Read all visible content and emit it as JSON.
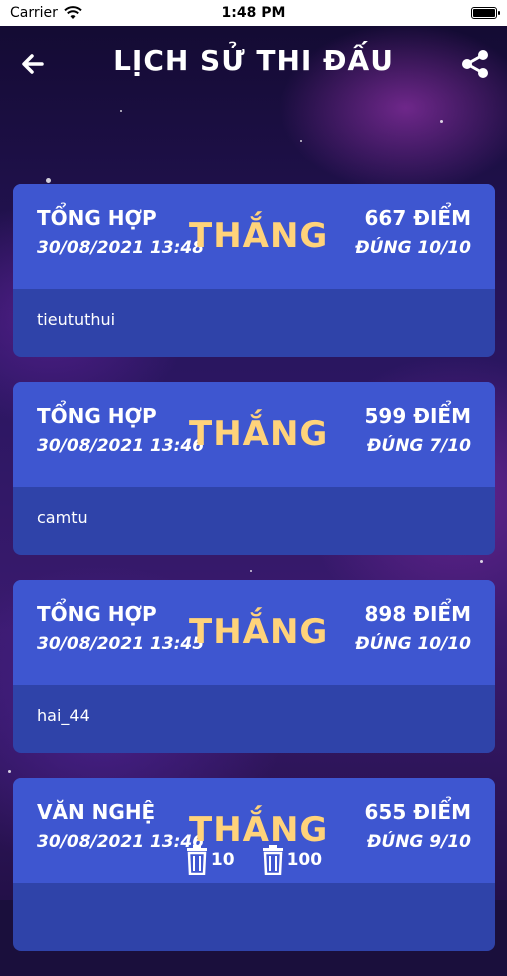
{
  "status_bar": {
    "carrier": "Carrier",
    "time": "1:48 PM"
  },
  "header": {
    "title": "LỊCH SỬ THI ĐẤU",
    "back_icon": "arrow-left-icon",
    "share_icon": "share-icon"
  },
  "matches": [
    {
      "category": "TỔNG HỢP",
      "datetime": "30/08/2021 13:48",
      "result": "THẮNG",
      "score": "667 ĐIỂM",
      "correct": "ĐÚNG 10/10",
      "user": "tieututhui"
    },
    {
      "category": "TỔNG HỢP",
      "datetime": "30/08/2021 13:46",
      "result": "THẮNG",
      "score": "599 ĐIỂM",
      "correct": "ĐÚNG 7/10",
      "user": "camtu"
    },
    {
      "category": "TỔNG HỢP",
      "datetime": "30/08/2021 13:45",
      "result": "THẮNG",
      "score": "898 ĐIỂM",
      "correct": "ĐÚNG 10/10",
      "user": "hai_44"
    },
    {
      "category": "VĂN NGHỆ",
      "datetime": "30/08/2021 13:46",
      "result": "THẮNG",
      "score": "655 ĐIỂM",
      "correct": "ĐÚNG 9/10",
      "user": ""
    }
  ],
  "bottom_actions": [
    {
      "icon": "trash-icon",
      "label": "10"
    },
    {
      "icon": "trash-icon",
      "label": "100"
    }
  ],
  "colors": {
    "card_top": "#3e56d0",
    "card_bottom": "#2f43a9",
    "result": "#ffd37a"
  }
}
